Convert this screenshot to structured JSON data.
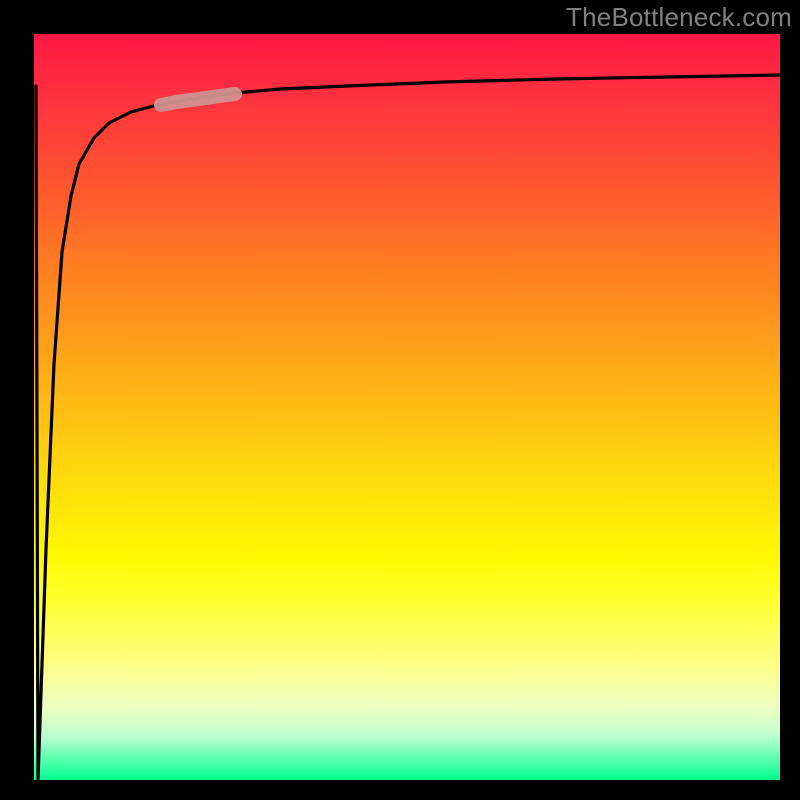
{
  "watermark": "TheBottleneck.com",
  "chart_data": {
    "type": "line",
    "title": "",
    "xlabel": "",
    "ylabel": "",
    "xlim": [
      0,
      100
    ],
    "ylim": [
      0,
      100
    ],
    "background_gradient": {
      "top": "#ff1744",
      "mid": "#ffff30",
      "bottom": "#00ff90"
    },
    "series": [
      {
        "name": "curve",
        "color": "#000000",
        "x": [
          0,
          1,
          2,
          3,
          4,
          5,
          6,
          8,
          10,
          13,
          17,
          22,
          27,
          33,
          42,
          55,
          70,
          85,
          100
        ],
        "values": [
          93,
          0,
          30,
          55,
          70,
          78,
          82,
          86,
          88,
          89.5,
          90.5,
          91.3,
          92,
          92.5,
          93,
          93.5,
          93.9,
          94.2,
          94.5
        ]
      },
      {
        "name": "highlight-segment",
        "color": "#d0918f",
        "x": [
          17,
          19,
          21,
          23,
          25,
          27
        ],
        "values": [
          90.2,
          90.6,
          90.9,
          91.2,
          91.5,
          91.8
        ]
      }
    ]
  }
}
